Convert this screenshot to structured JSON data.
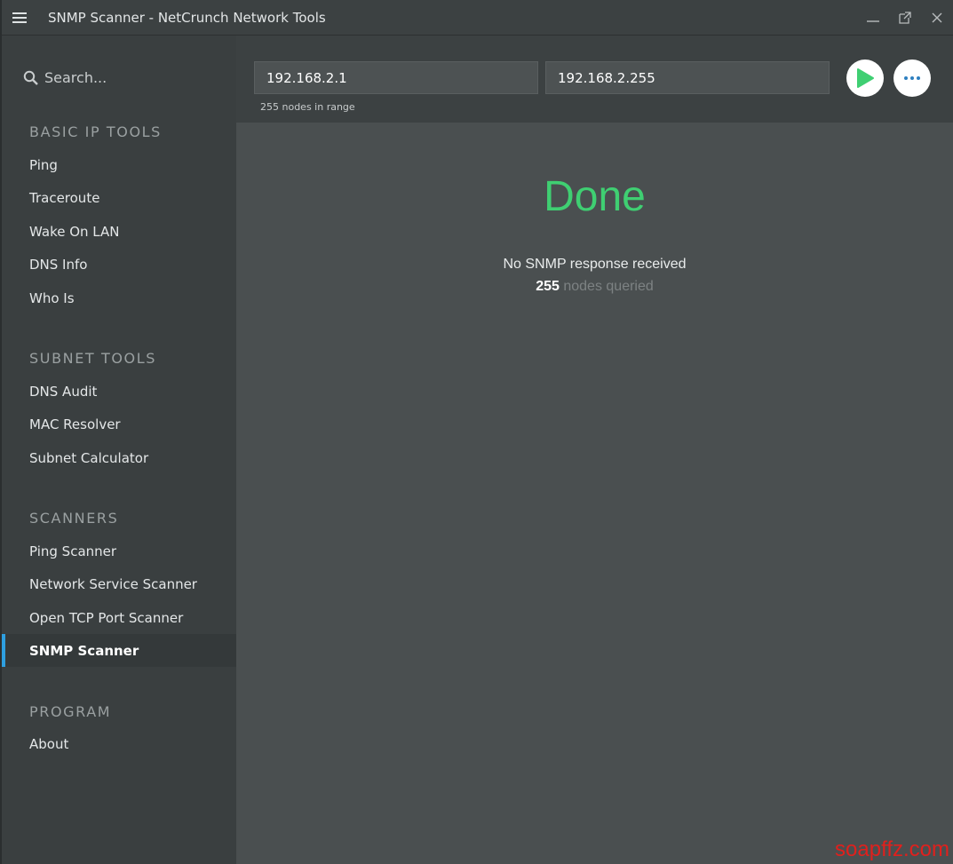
{
  "window": {
    "title": "SNMP Scanner - NetCrunch Network Tools"
  },
  "sidebar": {
    "search_placeholder": "Search...",
    "sections": [
      {
        "title": "BASIC IP TOOLS",
        "items": [
          "Ping",
          "Traceroute",
          "Wake On LAN",
          "DNS Info",
          "Who Is"
        ]
      },
      {
        "title": "SUBNET TOOLS",
        "items": [
          "DNS Audit",
          "MAC Resolver",
          "Subnet Calculator"
        ]
      },
      {
        "title": "SCANNERS",
        "items": [
          "Ping Scanner",
          "Network Service Scanner",
          "Open TCP Port Scanner",
          "SNMP Scanner"
        ]
      },
      {
        "title": "PROGRAM",
        "items": [
          "About"
        ]
      }
    ],
    "active_item": "SNMP Scanner"
  },
  "toolbar": {
    "start_ip": "192.168.2.1",
    "end_ip": "192.168.2.255",
    "range_hint": "255 nodes in range",
    "run_icon": "play-icon",
    "more_icon": "more-options-icon"
  },
  "result": {
    "status": "Done",
    "message": "No SNMP response received",
    "count": "255",
    "count_label": "nodes queried"
  },
  "watermark": "soapffz.com",
  "colors": {
    "accent": "#2e9fe0",
    "success": "#3fcf72",
    "sidebar_bg": "#3a3f40",
    "content_bg": "#4a4f50"
  }
}
